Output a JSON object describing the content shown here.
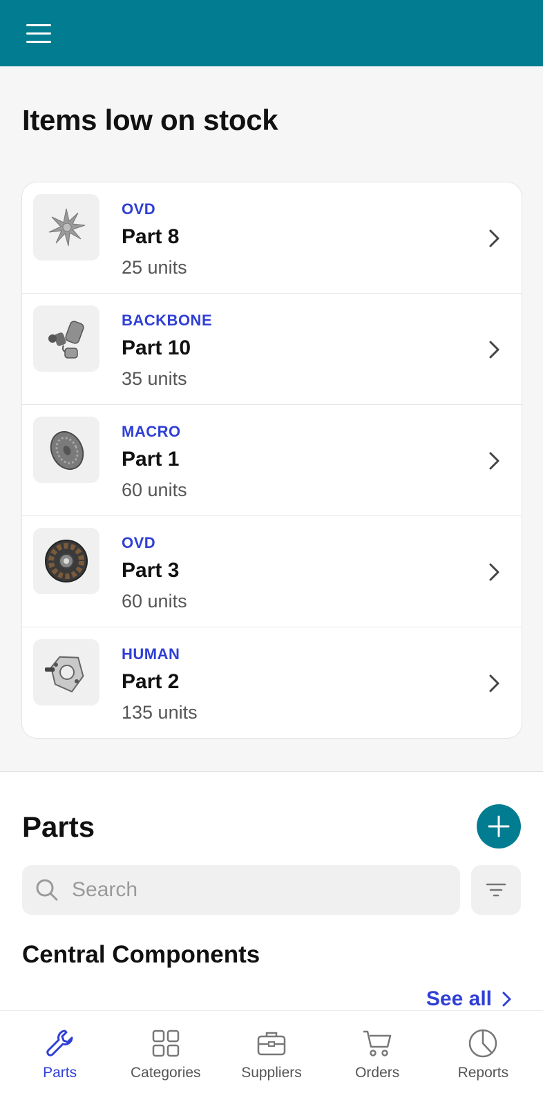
{
  "low_stock": {
    "title": "Items low on stock",
    "items": [
      {
        "category": "OVD",
        "name": "Part 8",
        "units": "25 units",
        "icon": "part-gear-icon"
      },
      {
        "category": "BACKBONE",
        "name": "Part 10",
        "units": "35 units",
        "icon": "part-motor-icon"
      },
      {
        "category": "MACRO",
        "name": "Part 1",
        "units": "60 units",
        "icon": "part-disc-icon"
      },
      {
        "category": "OVD",
        "name": "Part 3",
        "units": "60 units",
        "icon": "part-stator-icon"
      },
      {
        "category": "HUMAN",
        "name": "Part 2",
        "units": "135 units",
        "icon": "part-bracket-icon"
      }
    ]
  },
  "parts": {
    "title": "Parts",
    "search_placeholder": "Search",
    "group_title": "Central Components",
    "see_all": "See all"
  },
  "nav": {
    "items": [
      {
        "label": "Parts",
        "icon": "wrench-icon",
        "active": true
      },
      {
        "label": "Categories",
        "icon": "grid-icon",
        "active": false
      },
      {
        "label": "Suppliers",
        "icon": "briefcase-icon",
        "active": false
      },
      {
        "label": "Orders",
        "icon": "cart-icon",
        "active": false
      },
      {
        "label": "Reports",
        "icon": "pie-chart-icon",
        "active": false
      }
    ]
  },
  "colors": {
    "primary": "#017c90",
    "accent": "#2f3fd6",
    "background": "#f6f6f6"
  }
}
